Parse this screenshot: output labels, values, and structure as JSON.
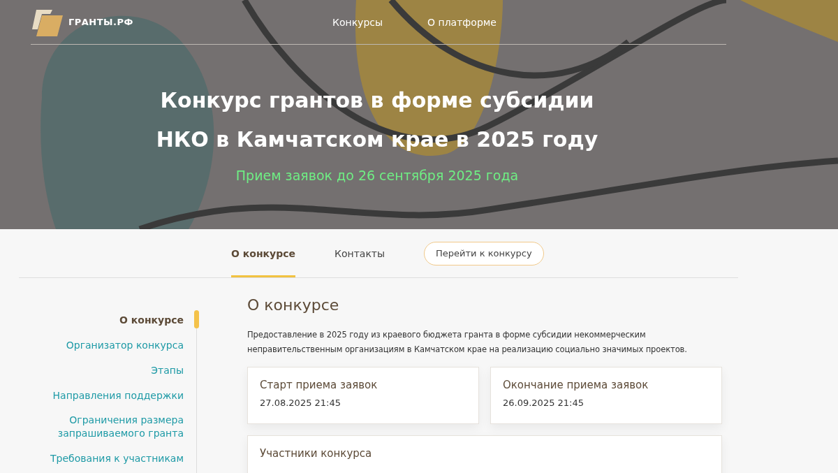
{
  "header": {
    "logo_text": "ГРАНТЫ.РФ",
    "nav": [
      {
        "label": "Конкурсы"
      },
      {
        "label": "О платформе"
      }
    ]
  },
  "hero": {
    "title_lines": [
      "Конкурс грантов в форме субсидии",
      "НКО в Камчатском крае в 2025 году"
    ],
    "deadline": "Прием заявок до 26 сентября 2025 года"
  },
  "tabs": [
    {
      "label": "О конкурсе",
      "selected": true
    },
    {
      "label": "Контакты",
      "selected": false
    }
  ],
  "cta_button": "Перейти к конкурсу",
  "sidebar": {
    "items": [
      {
        "label": "О конкурсе",
        "selected": true
      },
      {
        "label": "Организатор конкурса",
        "selected": false
      },
      {
        "label": "Этапы",
        "selected": false
      },
      {
        "label": "Направления поддержки",
        "selected": false
      },
      {
        "label": "Ограничения размера запрашиваемого гранта",
        "selected": false
      },
      {
        "label": "Требования к участникам",
        "selected": false
      }
    ]
  },
  "content": {
    "heading": "О конкурсе",
    "description": "Предоставление в 2025 году из краевого бюджета гранта в форме субсидии некоммерческим неправительственным организациям в Камчатском крае на реализацию социально значимых проектов.",
    "cards": [
      {
        "title": "Старт приема заявок",
        "value": "27.08.2025 21:45"
      },
      {
        "title": "Окончание приема заявок",
        "value": "26.09.2025 21:45"
      },
      {
        "title": "Участники конкурса"
      }
    ]
  }
}
